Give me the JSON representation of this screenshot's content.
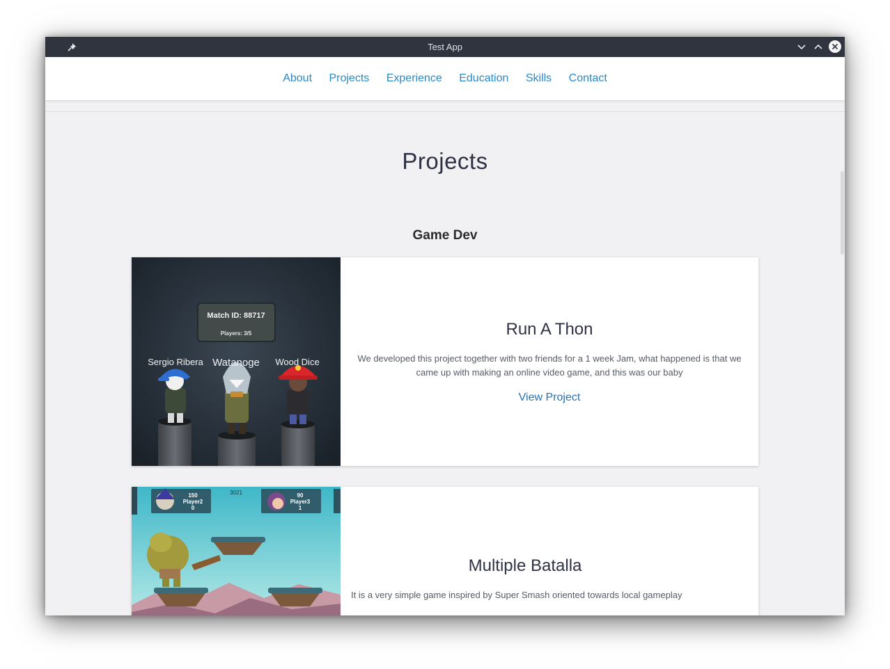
{
  "window": {
    "title": "Test App"
  },
  "nav": {
    "items": [
      "About",
      "Projects",
      "Experience",
      "Education",
      "Skills",
      "Contact"
    ]
  },
  "section": {
    "title": "Projects",
    "subtitle": "Game Dev"
  },
  "projects": [
    {
      "title": "Run A Thon",
      "description": "We developed this project together with two friends for a 1 week Jam, what happened is that we came up with making an online video game, and this was our baby",
      "link_label": "View Project",
      "thumb": {
        "match_label": "Match ID: 88717",
        "players_label": "Players: 3/5",
        "player_names": [
          "Sergio Ribera",
          "Watanoge",
          "Wood Dice"
        ]
      }
    },
    {
      "title": "Multiple Batalla",
      "description": "It is a very simple game inspired by Super Smash oriented towards local gameplay",
      "thumb": {
        "score_top": "3021",
        "p1_score": "150",
        "p1_name": "Player2",
        "p1_lives": "0",
        "p2_score": "90",
        "p2_name": "Player3",
        "p2_lives": "1"
      }
    }
  ],
  "colors": {
    "accent": "#2b89c6",
    "titlebar": "#2f343f",
    "page_bg": "#f1f1f3"
  }
}
